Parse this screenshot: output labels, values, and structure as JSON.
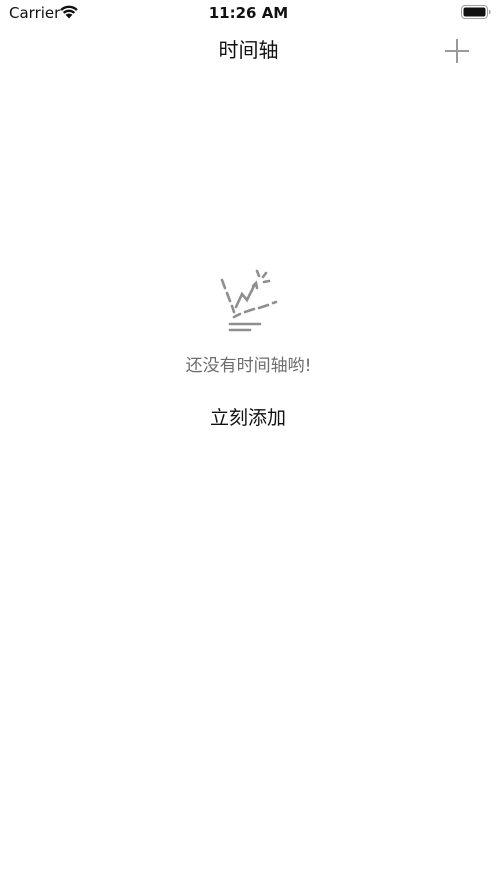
{
  "status_bar": {
    "carrier": "Carrier",
    "time": "11:26 AM",
    "wifi_icon": "wifi-icon",
    "battery_icon": "battery-icon"
  },
  "nav_bar": {
    "title": "时间轴",
    "add_icon": "plus-icon"
  },
  "empty_state": {
    "illustration_icon": "empty-chart-icon",
    "message": "还没有时间轴哟!",
    "action_label": "立刻添加"
  },
  "colors": {
    "background": "#ffffff",
    "text": "#111111",
    "secondary_text": "#6d6d6d",
    "icon_gray": "#9a9a9a"
  }
}
